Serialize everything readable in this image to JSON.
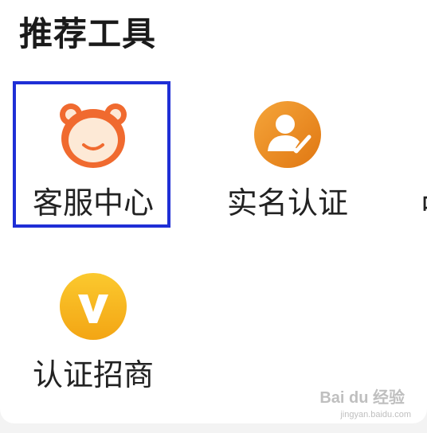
{
  "section": {
    "title": "推荐工具"
  },
  "tools": [
    {
      "label": "客服中心",
      "icon": "bear-face-icon",
      "color": "#f06a2f",
      "selected": true
    },
    {
      "label": "实名认证",
      "icon": "user-verified-icon",
      "color": "#ee8a1e",
      "selected": false
    },
    {
      "label": "认证招商",
      "icon": "v-badge-icon",
      "color": "#f7b51c",
      "selected": false
    }
  ],
  "partial_next_label": "中",
  "highlight_color": "#1f2fd6",
  "watermark": {
    "text": "Bai du 经验",
    "subtext": "jingyan.baidu.com"
  }
}
